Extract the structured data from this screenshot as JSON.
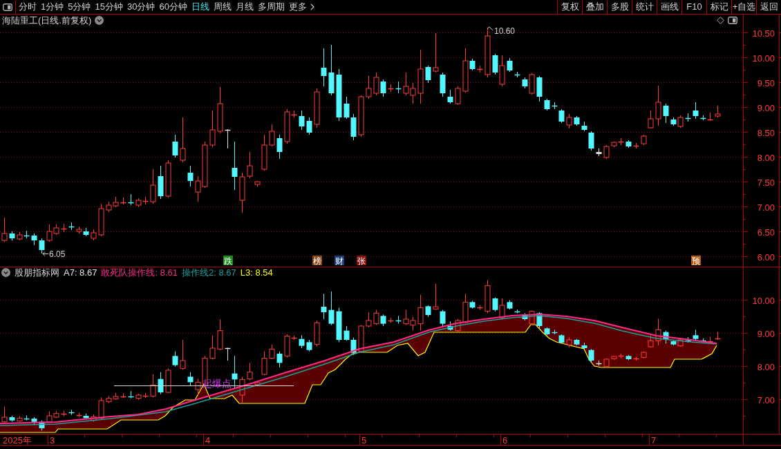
{
  "toolbar": {
    "periods": [
      {
        "label": "分时",
        "selected": false
      },
      {
        "label": "1分钟",
        "selected": false
      },
      {
        "label": "5分钟",
        "selected": false
      },
      {
        "label": "15分钟",
        "selected": false
      },
      {
        "label": "30分钟",
        "selected": false
      },
      {
        "label": "60分钟",
        "selected": false
      },
      {
        "label": "日线",
        "selected": true
      },
      {
        "label": "周线",
        "selected": false
      },
      {
        "label": "月线",
        "selected": false
      },
      {
        "label": "多周期",
        "selected": false
      }
    ],
    "more": "更多",
    "actions": [
      "复权",
      "叠加",
      "多股",
      "统计",
      "画线",
      "F10",
      "标记",
      "+自选",
      "返回"
    ]
  },
  "price_panel": {
    "title": "海陆重工(日线.前复权)",
    "high_label": "10.60",
    "low_label": "6.05",
    "y_axis": [
      "10.50",
      "10.00",
      "9.50",
      "9.00",
      "8.50",
      "8.00",
      "7.50",
      "7.00",
      "6.50",
      "6.00"
    ],
    "events": [
      {
        "label": "跌",
        "color": "#1c8a1c"
      },
      {
        "label": "榜",
        "color": "#8b4a1a"
      },
      {
        "label": "财",
        "color": "#1e3c78"
      },
      {
        "label": "张",
        "color": "#8a1010"
      },
      {
        "label": "预",
        "color": "#b05a1a"
      }
    ]
  },
  "indicator_panel": {
    "name": "股朋指标网",
    "series": [
      {
        "text": "A7: 8.67",
        "color": "#e6e6e6"
      },
      {
        "text": "敢死队操作线: 8.61",
        "color": "#ff2a8a"
      },
      {
        "text": "操作线2: 8.67",
        "color": "#1aa0a0"
      },
      {
        "text": "L3: 8.54",
        "color": "#ffff00"
      }
    ],
    "signal_label": "起爆点",
    "y_axis": [
      "10.00",
      "9.00",
      "8.00",
      "7.00"
    ]
  },
  "time_axis": [
    "2025年",
    "3",
    "4",
    "5",
    "6",
    "7"
  ]
}
